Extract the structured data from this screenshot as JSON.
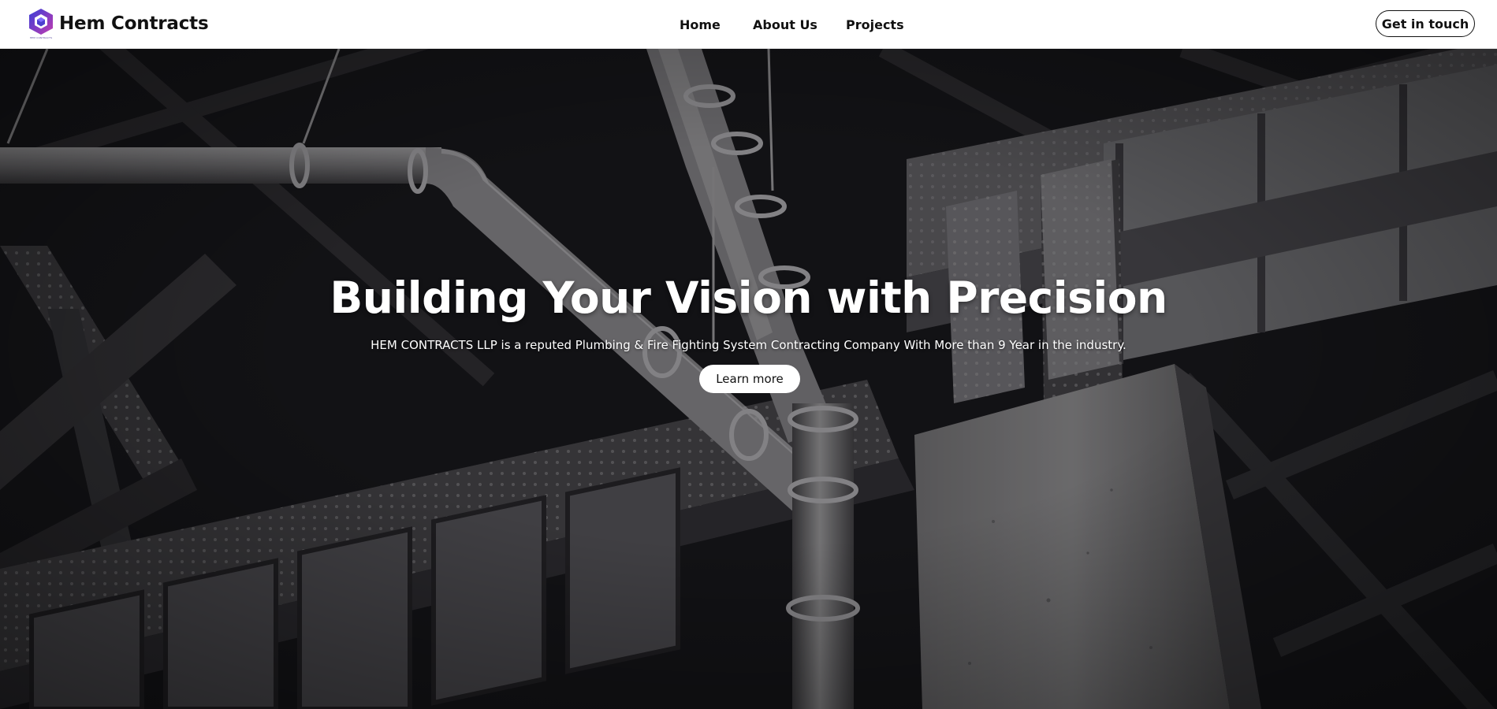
{
  "header": {
    "logo_icon": "hexagon-cube-logo-icon",
    "logo_tagline": "HEM CONTRACTS",
    "brand": "Hem Contracts",
    "nav": [
      {
        "label": "Home"
      },
      {
        "label": "About Us"
      },
      {
        "label": "Projects"
      }
    ],
    "cta_label": "Get in touch"
  },
  "hero": {
    "title": "Building Your Vision with Precision",
    "subtitle": "HEM CONTRACTS LLP is a reputed Plumbing & Fire Fighting System Contracting Company With More than 9 Year in the industry.",
    "button_label": "Learn more",
    "background_image": "black-and-white industrial steel beams and pipes"
  },
  "colors": {
    "logo_primary": "#5b3fd0",
    "logo_secondary": "#c23bb0",
    "text_dark": "#111111",
    "hero_text": "#ffffff"
  }
}
